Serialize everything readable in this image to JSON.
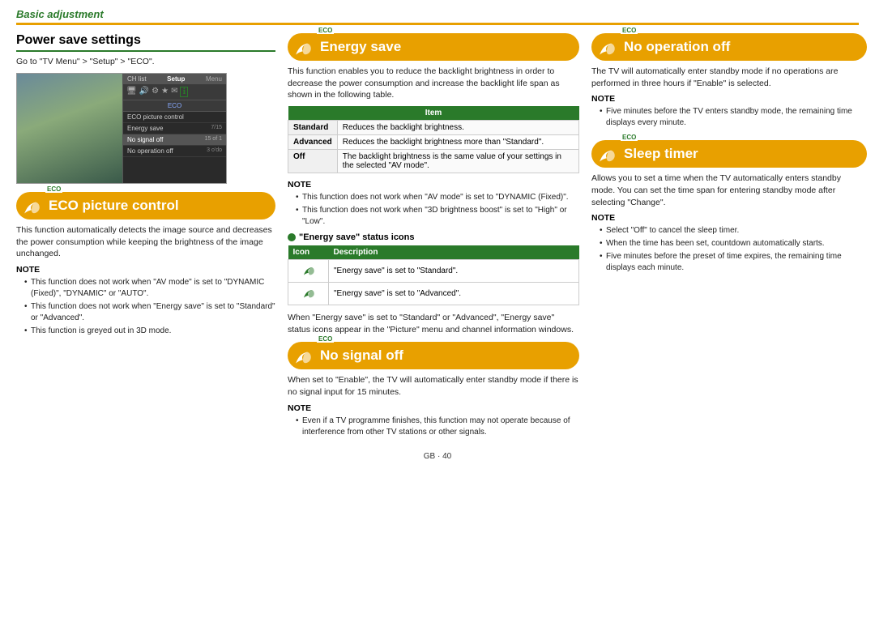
{
  "header": {
    "title": "Basic adjustment"
  },
  "col_left": {
    "power_save": {
      "title": "Power save settings",
      "go_to": "Go to \"TV Menu\" > \"Setup\" > \"ECO\".",
      "tv_menu": {
        "topbar_label": "Menu",
        "tabs": [
          {
            "label": "CH list",
            "active": false
          },
          {
            "label": "Setup",
            "active": true
          }
        ],
        "icons": [
          "tv",
          "speaker",
          "wrench",
          "star",
          "mail",
          "info"
        ],
        "eco_label": "ECO",
        "items": [
          {
            "label": "ECO picture control",
            "value": ""
          },
          {
            "label": "Energy save",
            "value": "7/15"
          },
          {
            "label": "No signal off",
            "value": "15 of 1"
          },
          {
            "label": "No operation off",
            "value": "3 o'do"
          }
        ]
      }
    },
    "eco_picture": {
      "eco_badge": "ECO",
      "title": "ECO picture control",
      "body": "This function automatically detects the image source and decreases the power consumption while keeping the brightness of the image unchanged.",
      "note_title": "NOTE",
      "notes": [
        "This function does not work when \"AV mode\" is set to \"DYNAMIC (Fixed)\", \"DYNAMIC\" or \"AUTO\".",
        "This function does not work when \"Energy save\" is set to \"Standard\" or \"Advanced\".",
        "This function is greyed out in 3D mode."
      ]
    }
  },
  "col_mid": {
    "energy_save": {
      "eco_badge": "ECO",
      "title": "Energy save",
      "body": "This function enables you to reduce the backlight brightness in order to decrease the power consumption and increase the backlight life span as shown in the following table.",
      "table": {
        "col_header": "Item",
        "rows": [
          {
            "item": "Standard",
            "desc": "Reduces the backlight brightness."
          },
          {
            "item": "Advanced",
            "desc": "Reduces the backlight brightness more than \"Standard\"."
          },
          {
            "item": "Off",
            "desc": "The backlight brightness is the same value of your settings in the selected \"AV mode\"."
          }
        ]
      },
      "note_title": "NOTE",
      "notes": [
        "This function does not work when \"AV mode\" is set to \"DYNAMIC (Fixed)\".",
        "This function does not work when \"3D brightness boost\" is set to \"High\" or \"Low\"."
      ]
    },
    "energy_status": {
      "subsection_title": "\"Energy save\" status icons",
      "table": {
        "col1": "Icon",
        "col2": "Description",
        "rows": [
          {
            "desc": "\"Energy save\" is set to \"Standard\"."
          },
          {
            "desc": "\"Energy save\" is set to \"Advanced\"."
          }
        ]
      },
      "body": "When \"Energy save\" is set to \"Standard\" or \"Advanced\", \"Energy save\" status icons appear in the \"Picture\" menu and channel information windows."
    },
    "no_signal": {
      "eco_badge": "ECO",
      "title": "No signal off",
      "body": "When set to \"Enable\", the TV will automatically enter standby mode if there is no signal input for 15 minutes.",
      "note_title": "NOTE",
      "notes": [
        "Even if a TV programme finishes, this function may not operate because of interference from other TV stations or other signals."
      ]
    }
  },
  "col_right": {
    "no_operation": {
      "eco_badge": "ECO",
      "title": "No operation off",
      "body": "The TV will automatically enter standby mode if no operations are performed in three hours if \"Enable\" is selected.",
      "note_title": "NOTE",
      "notes": [
        "Five minutes before the TV enters standby mode, the remaining time displays every minute."
      ]
    },
    "sleep_timer": {
      "eco_badge": "ECO",
      "title": "Sleep timer",
      "body": "Allows you to set a time when the TV automatically enters standby mode. You can set the time span for entering standby mode after selecting \"Change\".",
      "note_title": "NOTE",
      "notes": [
        "Select \"Off\" to cancel the sleep timer.",
        "When the time has been set, countdown automatically starts.",
        "Five minutes before the preset of time expires, the remaining time displays each minute."
      ]
    }
  },
  "footer": {
    "text": "GB · 40"
  }
}
